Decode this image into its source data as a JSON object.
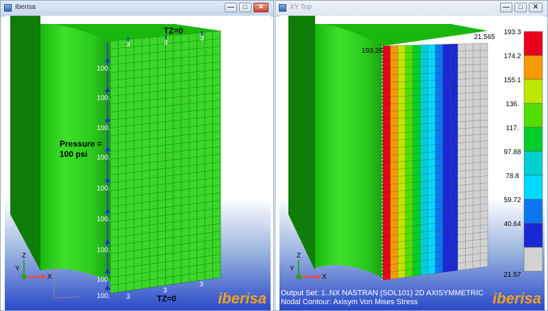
{
  "left_window": {
    "title": "Iberisa",
    "controls": {
      "minimize": "—",
      "maximize": "□",
      "close": "✕"
    },
    "annotations": {
      "tz_top": "TZ=0",
      "tz_bottom": "TZ=0",
      "pressure_line1": "Pressure =",
      "pressure_line2": "100 psi",
      "load_value": "100.",
      "constraint_label": "3"
    },
    "axis": {
      "y": "Y",
      "z": "Z",
      "x": "X"
    },
    "logo": "iberisa"
  },
  "right_window": {
    "title": "XY Top",
    "controls": {
      "minimize": "—",
      "maximize": "□",
      "close": "✕"
    },
    "max_label": "193.26",
    "min_label": "21.565",
    "output_set": "Output Set: 1..NX NASTRAN (SOL101) 2D AXISYMMETRIC",
    "contour_label": "Nodal Contour: Axisym Von Mises Stress",
    "axis": {
      "y": "Y",
      "z": "Z",
      "x": "X"
    },
    "logo": "iberisa"
  },
  "legend": {
    "labels": [
      "193.3",
      "174.2",
      "155.1",
      "136.",
      "117.",
      "97.88",
      "78.8",
      "59.72",
      "40.64",
      "21.57"
    ],
    "colors": [
      "#e8001c",
      "#f59a00",
      "#bde600",
      "#53dc00",
      "#00cf2b",
      "#00cfd0",
      "#00d8ff",
      "#0a76f0",
      "#1a28d4",
      "#d2d2d2"
    ]
  },
  "contour_columns": [
    "#e8001c",
    "#f59a00",
    "#bde600",
    "#53dc00",
    "#00cf2b",
    "#00cfd0",
    "#00d8ff",
    "#0a76f0",
    "#1a28d4",
    "#1a28d4",
    "#d2d2d2",
    "#d2d2d2",
    "#d2d2d2",
    "#d2d2d2"
  ]
}
